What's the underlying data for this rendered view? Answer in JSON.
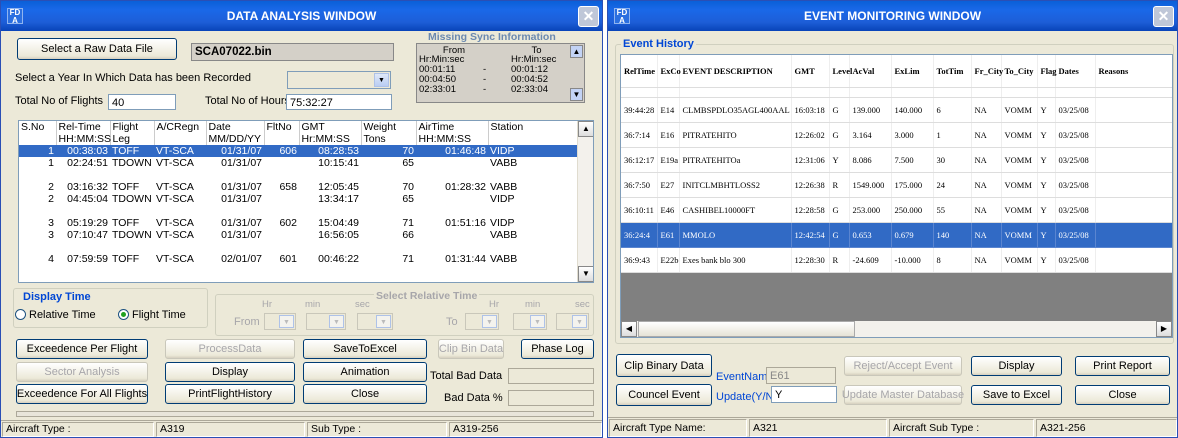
{
  "w1": {
    "title": "DATA ANALYSIS WINDOW",
    "select_raw_btn": "Select a Raw Data File",
    "file_name": "SCA07022.bin",
    "year_label": "Select a Year In Which Data has been Recorded",
    "flights_label": "Total No of Flights",
    "flights_value": "40",
    "hours_label": "Total No of Hours",
    "hours_value": "75:32:27",
    "sync": {
      "title": "Missing Sync Information",
      "from_h": "From",
      "to_h": "To",
      "from_u": "Hr:Min:sec",
      "to_u": "Hr:Min:sec",
      "rows": [
        {
          "from": "00:01:11",
          "dash": "-",
          "to": "00:01:12"
        },
        {
          "from": "00:04:50",
          "dash": "-",
          "to": "00:04:52"
        },
        {
          "from": "02:33:01",
          "dash": "-",
          "to": "02:33:04"
        }
      ]
    },
    "table": {
      "headers": [
        "S.No",
        "Rel-Time",
        "Flight",
        "A/CRegn",
        "Date",
        "FltNo",
        "GMT",
        "Weight",
        "AirTime",
        "Station"
      ],
      "sub": [
        "",
        "HH:MM:SS",
        "Leg",
        "",
        "MM/DD/YY",
        "",
        "Hr:MM:SS",
        "Tons",
        "HH:MM:SS",
        ""
      ],
      "rows": [
        [
          "1",
          "00:38:03",
          "TOFF",
          "VT-SCA",
          "01/31/07",
          "606",
          "08:28:53",
          "70",
          "01:46:48",
          "VIDP"
        ],
        [
          "1",
          "02:24:51",
          "TDOWN",
          "VT-SCA",
          "01/31/07",
          "",
          "10:15:41",
          "65",
          "",
          "VABB"
        ],
        [
          "",
          "",
          "",
          "",
          "",
          "",
          "",
          "",
          "",
          ""
        ],
        [
          "2",
          "03:16:32",
          "TOFF",
          "VT-SCA",
          "01/31/07",
          "658",
          "12:05:45",
          "70",
          "01:28:32",
          "VABB"
        ],
        [
          "2",
          "04:45:04",
          "TDOWN",
          "VT-SCA",
          "01/31/07",
          "",
          "13:34:17",
          "65",
          "",
          "VIDP"
        ],
        [
          "",
          "",
          "",
          "",
          "",
          "",
          "",
          "",
          "",
          ""
        ],
        [
          "3",
          "05:19:29",
          "TOFF",
          "VT-SCA",
          "01/31/07",
          "602",
          "15:04:49",
          "71",
          "01:51:16",
          "VIDP"
        ],
        [
          "3",
          "07:10:47",
          "TDOWN",
          "VT-SCA",
          "01/31/07",
          "",
          "16:56:05",
          "66",
          "",
          "VABB"
        ],
        [
          "",
          "",
          "",
          "",
          "",
          "",
          "",
          "",
          "",
          ""
        ],
        [
          "4",
          "07:59:59",
          "TOFF",
          "VT-SCA",
          "02/01/07",
          "601",
          "00:46:22",
          "71",
          "01:31:44",
          "VABB"
        ]
      ]
    },
    "display_time": "Display Time",
    "rel_time": "Relative Time",
    "flight_time": "Flight Time",
    "sel_rel_time": "Select Relative Time",
    "hr": "Hr",
    "min": "min",
    "sec": "sec",
    "from": "From",
    "to": "To",
    "btn_exc_per_flight": "Exceedence Per Flight",
    "btn_process": "ProcessData",
    "btn_save_excel": "SaveToExcel",
    "btn_clip_bin": "Clip Bin Data",
    "btn_phase_log": "Phase Log",
    "btn_sector": "Sector Analysis",
    "btn_display": "Display",
    "btn_animation": "Animation",
    "total_bad": "Total Bad Data",
    "btn_exc_all": "Exceedence For All Flights",
    "btn_print_hist": "PrintFlightHistory",
    "btn_close": "Close",
    "bad_pct": "Bad Data %",
    "status": {
      "ac_type_l": "Aircraft Type :",
      "ac_type": "A319",
      "sub_l": "Sub Type :",
      "sub": "A319-256"
    }
  },
  "w2": {
    "title": "EVENT MONITORING WINDOW",
    "group": "Event History",
    "headers": [
      "RelTime",
      "ExCo",
      "EVENT DESCRIPTION",
      "GMT",
      "Level",
      "AcVal",
      "ExLim",
      "TotTim",
      "Fr_City",
      "To_City",
      "Flag",
      "Dates",
      "Reasons"
    ],
    "rows": [
      [
        "39:44:28",
        "E14",
        "CLMBSPDLO35AGL400AAL",
        "16:03:18",
        "G",
        "139.000",
        "140.000",
        "6",
        "NA",
        "VOMM",
        "Y",
        "03/25/08",
        ""
      ],
      [
        "36:7:14",
        "E16",
        "PITRATEHITO",
        "12:26:02",
        "G",
        "3.164",
        "3.000",
        "1",
        "NA",
        "VOMM",
        "Y",
        "03/25/08",
        ""
      ],
      [
        "36:12:17",
        "E19a",
        "PITRATEHITOa",
        "12:31:06",
        "Y",
        "8.086",
        "7.500",
        "30",
        "NA",
        "VOMM",
        "Y",
        "03/25/08",
        ""
      ],
      [
        "36:7:50",
        "E27",
        "INITCLMBHTLOSS2",
        "12:26:38",
        "R",
        "1549.000",
        "175.000",
        "24",
        "NA",
        "VOMM",
        "Y",
        "03/25/08",
        ""
      ],
      [
        "36:10:11",
        "E46",
        "CASHIBEL10000FT",
        "12:28:58",
        "G",
        "253.000",
        "250.000",
        "55",
        "NA",
        "VOMM",
        "Y",
        "03/25/08",
        ""
      ],
      [
        "36:24:4",
        "E61",
        "MMOLO",
        "12:42:54",
        "G",
        "0.653",
        "0.679",
        "140",
        "NA",
        "VOMM",
        "Y",
        "03/25/08",
        ""
      ],
      [
        "36:9:43",
        "E22b",
        "Exes bank blo 300",
        "12:28:30",
        "R",
        "-24.609",
        "-10.000",
        "8",
        "NA",
        "VOMM",
        "Y",
        "03/25/08",
        ""
      ]
    ],
    "btn_clip": "Clip Binary Data",
    "event_name_l": "EventName",
    "event_name": "E61",
    "btn_reject": "Reject/Accept Event",
    "btn_display": "Display",
    "btn_print": "Print Report",
    "btn_council": "Councel Event",
    "update_l": "Update(Y/N)",
    "update_v": "Y",
    "btn_update_master": "Update Master Database",
    "btn_save_excel": "Save to Excel",
    "btn_close": "Close",
    "status": {
      "ac_type_l": "Aircraft Type Name:",
      "ac_type": "A321",
      "sub_l": "Aircraft Sub Type :",
      "sub": "A321-256"
    }
  }
}
